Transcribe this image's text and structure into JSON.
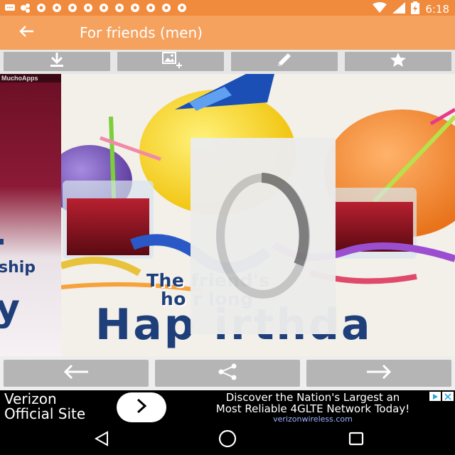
{
  "status_bar": {
    "time": "6:18",
    "notification_icons": [
      "message-icon",
      "link-icon",
      "ball-icon",
      "ball-icon",
      "ball-icon",
      "ball-icon",
      "ball-icon",
      "ball-icon",
      "ball-icon",
      "ball-icon",
      "ball-icon",
      "ball-icon"
    ],
    "right_icons": [
      "wifi-icon",
      "signal-icon",
      "battery-icon"
    ]
  },
  "app_bar": {
    "title": "For friends (men)",
    "back_icon": "arrow-back-icon"
  },
  "toolbar": {
    "buttons": [
      {
        "name": "download-button",
        "icon": "download-icon"
      },
      {
        "name": "add-image-button",
        "icon": "image-add-icon"
      },
      {
        "name": "edit-button",
        "icon": "pencil-icon"
      },
      {
        "name": "favorite-button",
        "icon": "star-icon"
      }
    ]
  },
  "card_previous": {
    "brand": "MuchoApps",
    "text_a": "ship",
    "text_b": "y"
  },
  "card_main": {
    "line1": "The           friend's",
    "line2": "ho              r long",
    "line3": "Hap     irthda"
  },
  "loader": {
    "icon": "loading-spinner-icon"
  },
  "nav": {
    "buttons": [
      {
        "name": "previous-button",
        "icon": "arrow-left-icon"
      },
      {
        "name": "share-button",
        "icon": "share-icon"
      },
      {
        "name": "next-button",
        "icon": "arrow-right-icon"
      }
    ]
  },
  "ad": {
    "left_line1": "Verizon",
    "left_line2": "Official Site",
    "right_line1": "Discover the Nation's Largest an",
    "right_line2": "Most Reliable 4GLTE Network Today!",
    "url": "verizonwireless.com",
    "colors": {
      "background": "#000000",
      "url": "#9bb4ff"
    }
  },
  "system_nav": {
    "buttons": [
      "back-triangle-icon",
      "home-circle-icon",
      "recents-square-icon"
    ]
  },
  "colors": {
    "status_bar": "#f08a3c",
    "app_bar": "#f5a25f",
    "toolbar_button": "#b1b1b1",
    "nav_button": "#b5b5b5",
    "card_text": "#1f3f7a"
  }
}
